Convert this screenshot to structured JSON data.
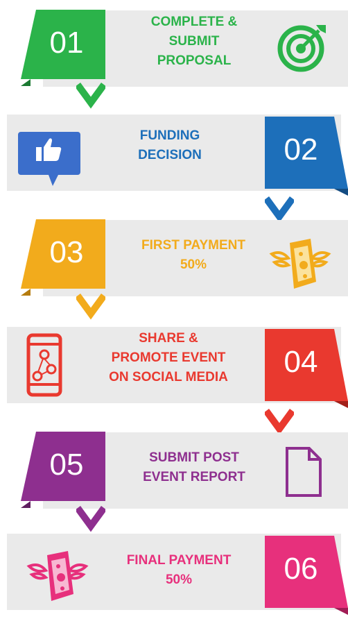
{
  "steps": [
    {
      "number": "01",
      "title": "COMPLETE &\nSUBMIT\nPROPOSAL",
      "color": "#2bb34a",
      "icon": "target-icon"
    },
    {
      "number": "02",
      "title": "FUNDING\nDECISION",
      "color": "#1d6fba",
      "icon": "thumbs-up-icon"
    },
    {
      "number": "03",
      "title": "FIRST PAYMENT\n50%",
      "color": "#f2ab1c",
      "icon": "flying-money-icon"
    },
    {
      "number": "04",
      "title": "SHARE &\nPROMOTE EVENT\nON SOCIAL MEDIA",
      "color": "#e9392f",
      "icon": "social-phone-icon"
    },
    {
      "number": "05",
      "title": "SUBMIT POST\nEVENT REPORT",
      "color": "#8e2f8f",
      "icon": "document-icon"
    },
    {
      "number": "06",
      "title": "FINAL PAYMENT\n50%",
      "color": "#e7307c",
      "icon": "flying-money-icon"
    }
  ]
}
